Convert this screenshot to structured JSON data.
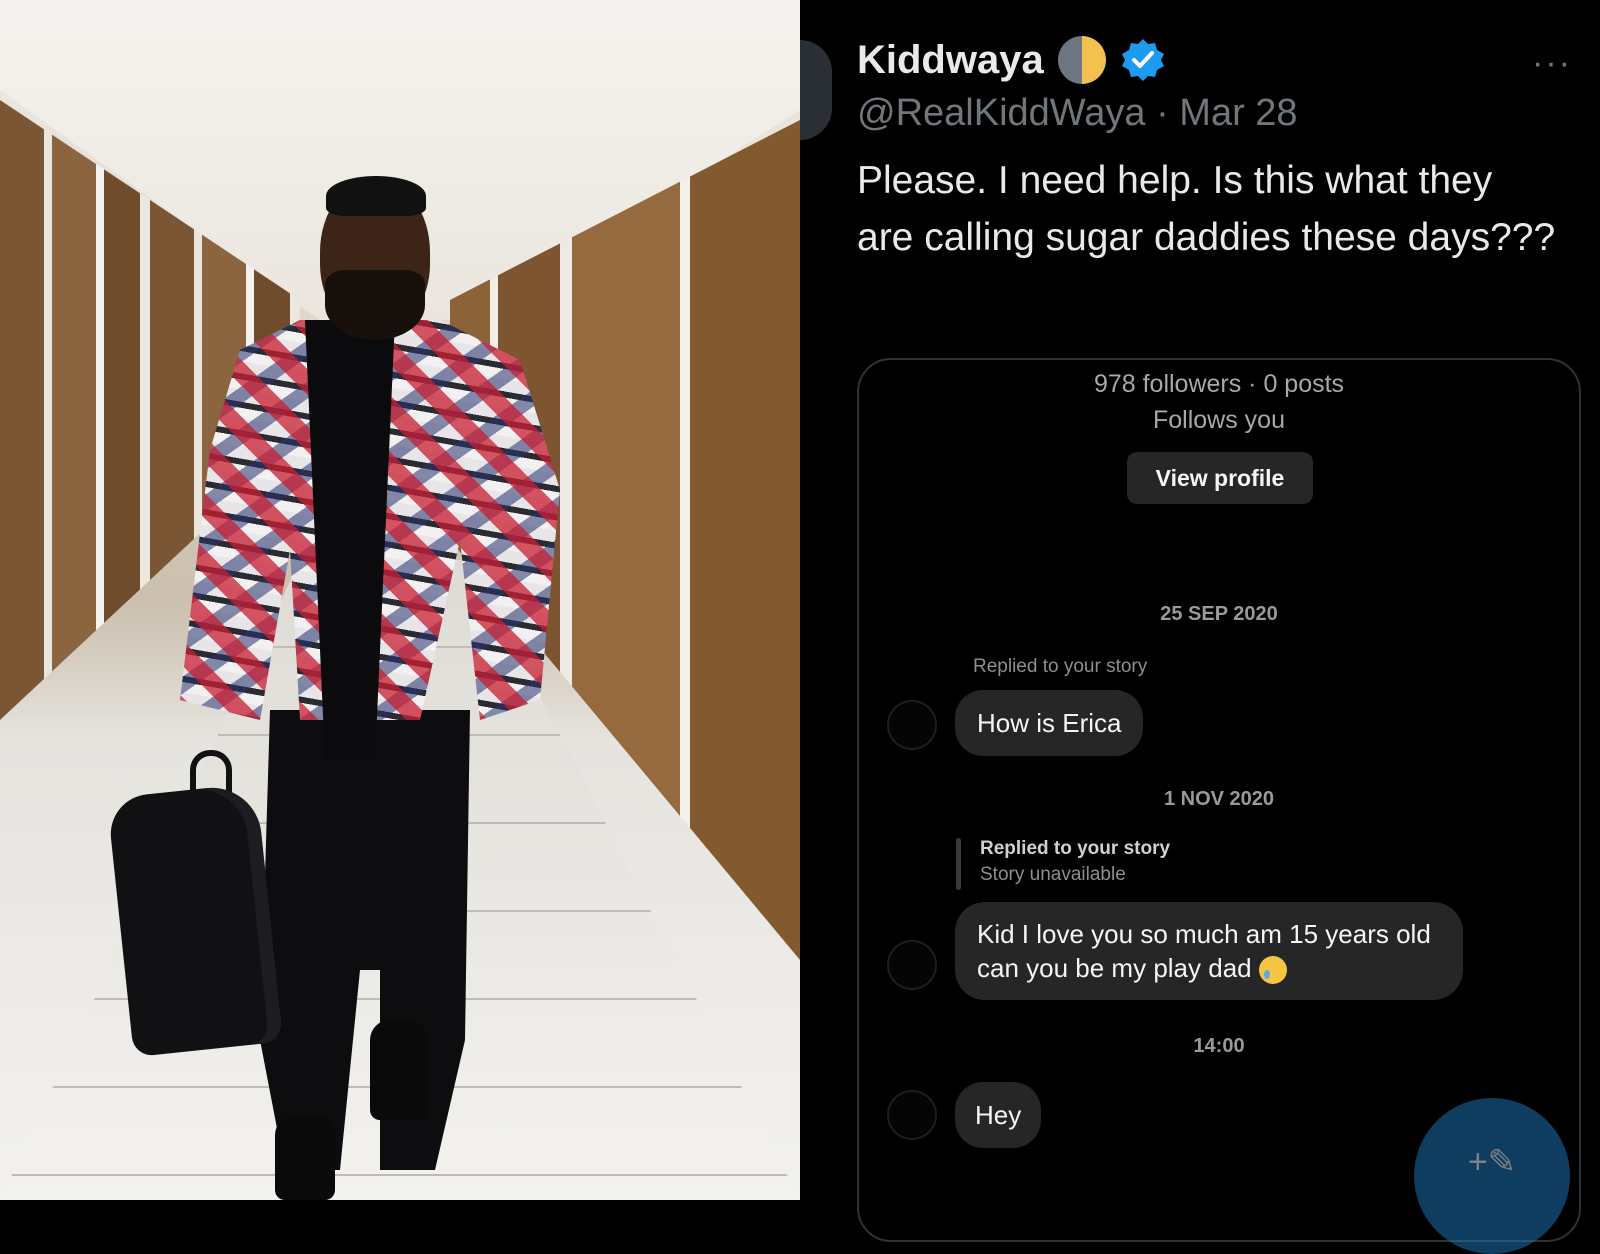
{
  "tweet": {
    "display_name": "Kiddwaya",
    "handle": "@RealKiddWaya",
    "date": "Mar 28",
    "text": "Please. I need help. Is this what they are calling sugar daddies these days???",
    "more_label": "···",
    "icons": [
      "half-moon-emoji-icon",
      "verified-badge-icon",
      "more-icon",
      "compose-icon"
    ],
    "colors": {
      "background": "#000000",
      "text": "#e7e9ea",
      "secondary": "#71767b",
      "verified": "#1d9bf0"
    }
  },
  "dm_screenshot": {
    "followers_line": "978 followers · 0 posts",
    "follows_you": "Follows you",
    "view_profile_label": "View profile",
    "date_1": "25 SEP 2020",
    "replied_label_1": "Replied to your story",
    "message_1": "How is Erica",
    "date_2": "1 NOV 2020",
    "replied_label_2": "Replied to your story",
    "story_unavailable": "Story unavailable",
    "message_2": "Kid I love you so much am 15 years old can you be my play dad",
    "time": "14:00",
    "message_3": "Hey",
    "icons": [
      "crying-emoji-icon"
    ]
  },
  "photo": {
    "description_icon": "hallway-photo"
  }
}
